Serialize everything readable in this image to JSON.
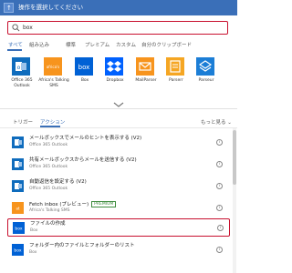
{
  "header": {
    "title": "操作を選択してください"
  },
  "search": {
    "value": "box"
  },
  "tabs": [
    "すべて",
    "組み込み",
    "標準",
    "プレミアム",
    "カスタム",
    "自分のクリップボード"
  ],
  "connectors": [
    {
      "name": "Office 365 Outlook",
      "color": "#0f6cbd",
      "icon": "outlook-icon"
    },
    {
      "name": "Africa's Talking SMS",
      "color": "#f7941d",
      "icon": "africas-talking-icon"
    },
    {
      "name": "Box",
      "color": "#0061d5",
      "icon": "box-icon"
    },
    {
      "name": "Dropbox",
      "color": "#0061fe",
      "icon": "dropbox-icon"
    },
    {
      "name": "MailParser",
      "color": "#f7941d",
      "icon": "mailparser-icon"
    },
    {
      "name": "Parserr",
      "color": "#f5a623",
      "icon": "parserr-icon"
    },
    {
      "name": "Parseur",
      "color": "#1c7ed6",
      "icon": "parseur-icon"
    }
  ],
  "subtabs": {
    "triggers": "トリガー",
    "actions": "アクション",
    "see_more": "もっと見る"
  },
  "actions": [
    {
      "title": "メールボックスでメールのヒントを表示する (V2)",
      "sub": "Office 365 Outlook",
      "color": "#0f6cbd"
    },
    {
      "title": "共有メールボックスからメールを送信する (V2)",
      "sub": "Office 365 Outlook",
      "color": "#0f6cbd"
    },
    {
      "title": "自動返信を設定する (V2)",
      "sub": "Office 365 Outlook",
      "color": "#0f6cbd"
    },
    {
      "title": "Fetch inbox (プレビュー)",
      "sub": "Africa's Talking SMS",
      "color": "#f7941d",
      "badge": "PREMIUM"
    },
    {
      "title": "ファイルの作成",
      "sub": "Box",
      "color": "#0061d5"
    },
    {
      "title": "フォルダー内のファイルとフォルダーのリスト",
      "sub": "Box",
      "color": "#0061d5"
    }
  ]
}
